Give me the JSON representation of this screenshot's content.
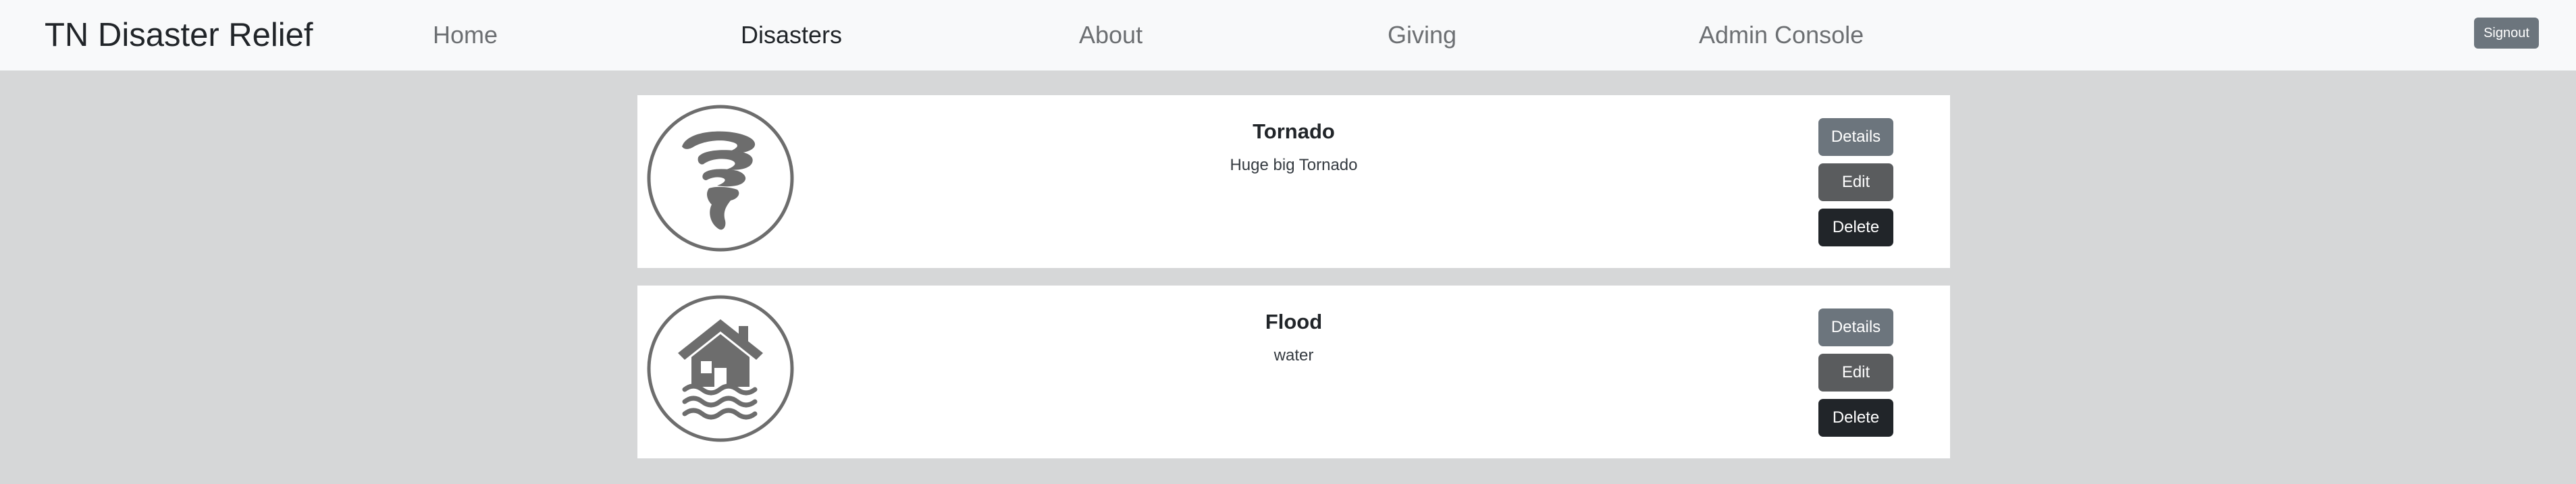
{
  "navbar": {
    "brand": "TN Disaster Relief",
    "links": [
      {
        "label": "Home",
        "active": false
      },
      {
        "label": "Disasters",
        "active": true
      },
      {
        "label": "About",
        "active": false
      },
      {
        "label": "Giving",
        "active": false
      },
      {
        "label": "Admin Console",
        "active": false
      }
    ],
    "signout_label": "Signout"
  },
  "disasters": [
    {
      "title": "Tornado",
      "description": "Huge big Tornado",
      "icon": "tornado-icon",
      "buttons": {
        "details": "Details",
        "edit": "Edit",
        "delete": "Delete"
      }
    },
    {
      "title": "Flood",
      "description": "water",
      "icon": "flooded-house-icon",
      "buttons": {
        "details": "Details",
        "edit": "Edit",
        "delete": "Delete"
      }
    }
  ],
  "colors": {
    "page_background": "#d6d7d8",
    "navbar_background": "#f8f9fa",
    "details_button": "#6c757d",
    "edit_button": "#5a5c5e",
    "delete_button": "#212529",
    "icon_gray": "#6d6d6d"
  }
}
